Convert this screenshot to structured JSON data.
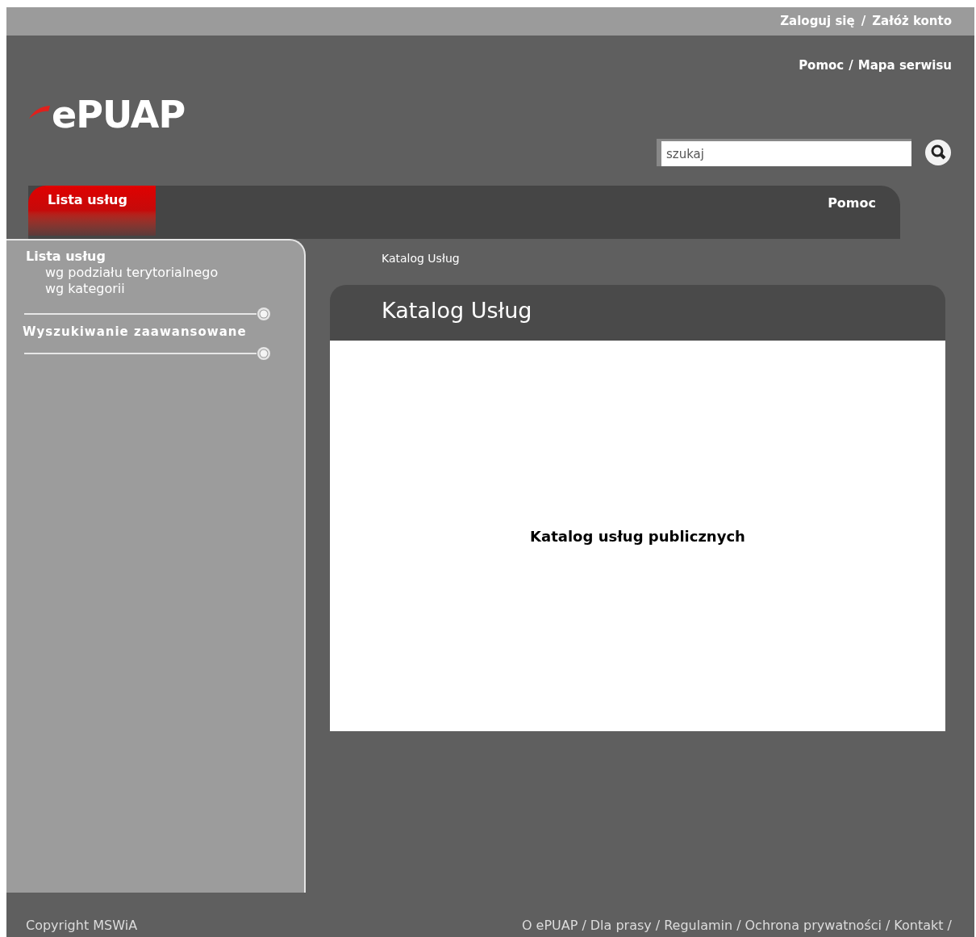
{
  "top_bar": {
    "links": [
      "Zaloguj się",
      "Załóż konto"
    ],
    "separator": "/"
  },
  "header": {
    "logo": "ePUAP",
    "links": [
      "Pomoc",
      "Mapa serwisu"
    ],
    "separator": "/",
    "search": {
      "placeholder": "szukaj"
    }
  },
  "tabs": [
    {
      "label": "Lista usług",
      "selected": true
    },
    {
      "label": "Pomoc",
      "selected": false
    }
  ],
  "sidebar": {
    "sections": [
      {
        "title": "Lista usług",
        "children": [
          {
            "label": "wg podziału terytorialnego"
          },
          {
            "label": "wg kategorii"
          }
        ]
      },
      {
        "title": "Wyszukiwanie zaawansowane"
      }
    ]
  },
  "breadcrumb": "Katalog Usług",
  "panel": {
    "title": "Katalog Usług",
    "body": "Katalog usług publicznych"
  },
  "footer": {
    "copyright": "Copyright MSWiA",
    "links": [
      "O ePUAP",
      "Dla prasy",
      "Regulamin",
      "Ochrona prywatności",
      "Kontakt"
    ],
    "separator": "/"
  }
}
